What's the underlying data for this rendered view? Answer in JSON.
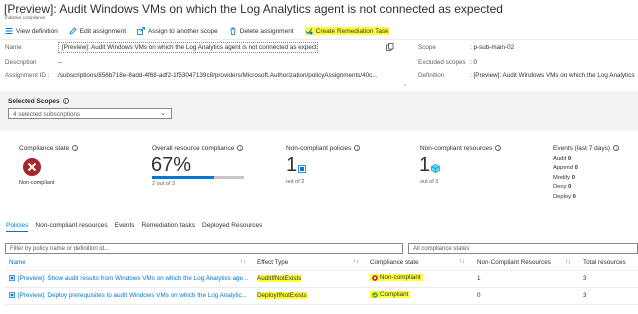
{
  "header": {
    "title": "[Preview]: Audit Windows VMs on which the Log Analytics agent is not connected as expected",
    "subtitle": "Initiative compliance"
  },
  "toolbar": {
    "view_definition": "View definition",
    "edit_assignment": "Edit assignment",
    "assign_scope": "Assign to another scope",
    "delete_assignment": "Delete assignment",
    "create_remediation": "Create Remediation Task"
  },
  "properties": {
    "name_label": "Name",
    "name_value": "[Preview]: Audit Windows VMs on which the Log Analytics agent is not connected as expected",
    "description_label": "Description",
    "description_value": "--",
    "assignment_id_label": "Assignment ID",
    "assignment_id_value": "/subscriptions/856b718e-8add-4f68-adf2-1f53047139c8/providers/Microsoft.Authorization/policyAssignments/40c...",
    "scope_label": "Scope",
    "scope_value": "p-sub-main-02",
    "excluded_label": "Excluded scopes",
    "excluded_value": "0",
    "definition_label": "Definition",
    "definition_value": "[Preview]: Audit Windows VMs on which the Log Analytics"
  },
  "scopes": {
    "label": "Selected Scopes",
    "value": "4 selected subscriptions"
  },
  "summary": {
    "compliance_state_title": "Compliance state",
    "compliance_state_value": "Non-compliant",
    "overall_title": "Overall resource compliance",
    "overall_percent": "67%",
    "overall_percent_value": 0.67,
    "overall_sub": "2 out of 3",
    "noncompliant_policies_title": "Non-compliant policies",
    "noncompliant_policies_num": "1",
    "noncompliant_policies_sub": "out of 2",
    "noncompliant_resources_title": "Non-compliant resources",
    "noncompliant_resources_num": "1",
    "noncompliant_resources_sub": "out of 3",
    "events_title": "Events (last 7 days)",
    "events": [
      {
        "label": "Audit",
        "value": "0"
      },
      {
        "label": "Append",
        "value": "0"
      },
      {
        "label": "Modify",
        "value": "0"
      },
      {
        "label": "Deny",
        "value": "0"
      },
      {
        "label": "Deploy",
        "value": "0"
      }
    ]
  },
  "tabs": [
    "Policies",
    "Non-compliant resources",
    "Events",
    "Remediation tasks",
    "Deployed Resources"
  ],
  "filter": {
    "placeholder": "Filter by policy name or definition id...",
    "state_value": "All compliance states"
  },
  "table": {
    "headers": [
      "Name",
      "Effect Type",
      "Compliance state",
      "Non-Compliant Resources",
      "Total resources"
    ],
    "rows": [
      {
        "name": "[Preview]: Show audit results from Windows VMs on which the Log Analytics age...",
        "effect": "AuditIfNotExists",
        "state": "Non-compliant",
        "noncompliant": "1",
        "total": "3"
      },
      {
        "name": "[Preview]: Deploy prerequisites to audit Windows VMs on which the Log Analytic...",
        "effect": "DeployIfNotExists",
        "state": "Compliant",
        "noncompliant": "0",
        "total": "3"
      }
    ]
  },
  "colors": {
    "accent": "#0078d4",
    "highlight": "#ffff3a",
    "error": "#c50f1f",
    "success": "#57a300",
    "warning": "#c19c00"
  }
}
